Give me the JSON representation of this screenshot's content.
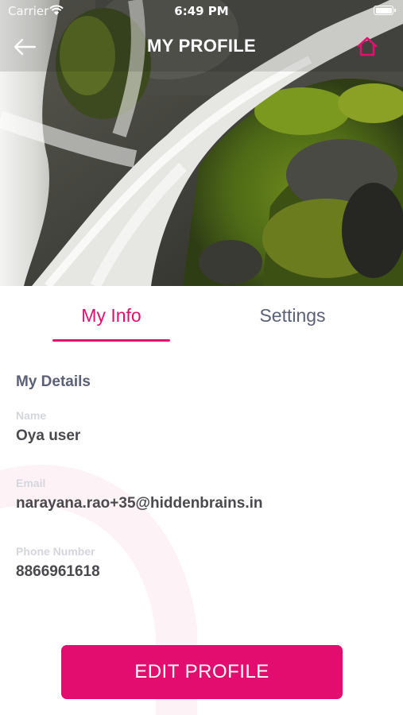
{
  "status_bar": {
    "carrier": "Carrier",
    "time": "6:49 PM",
    "battery_level": 1.0
  },
  "header": {
    "title": "MY PROFILE",
    "back_icon": "arrow-left-icon",
    "home_icon": "home-icon",
    "accent_color": "#e3106f"
  },
  "tabs": [
    {
      "label": "My Info",
      "selected": true
    },
    {
      "label": "Settings",
      "selected": false
    }
  ],
  "details": {
    "section_title": "My Details",
    "fields": [
      {
        "label": "Name",
        "value": "Oya user"
      },
      {
        "label": "Email",
        "value": "narayana.rao+35@hiddenbrains.in"
      },
      {
        "label": "Phone Number",
        "value": "8866961618"
      }
    ]
  },
  "actions": {
    "edit_profile_label": "EDIT PROFILE",
    "button_color": "#e30c6f"
  }
}
